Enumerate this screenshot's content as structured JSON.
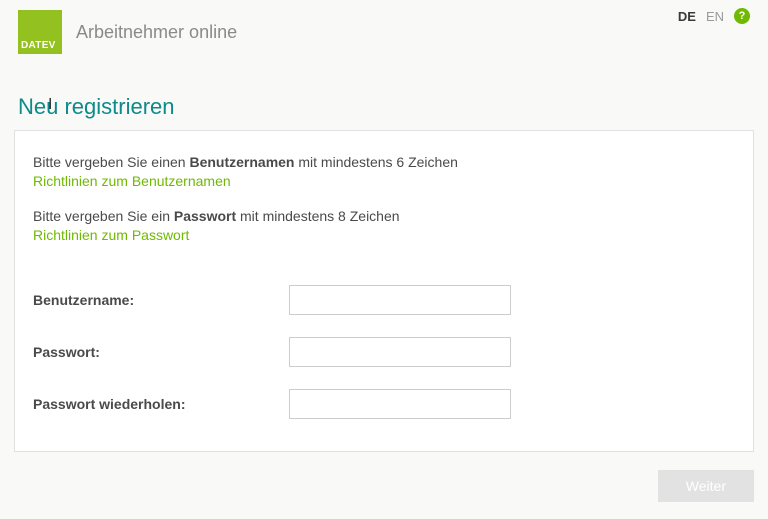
{
  "header": {
    "logo_text": "DATEV",
    "app_title": "Arbeitnehmer online",
    "lang_de": "DE",
    "lang_en": "EN",
    "help_symbol": "?"
  },
  "page": {
    "title": "Neu registrieren"
  },
  "panel": {
    "instr_username_pre": "Bitte vergeben Sie einen ",
    "instr_username_bold": "Benutzernamen",
    "instr_username_post": " mit mindestens 6 Zeichen",
    "link_username": "Richtlinien zum Benutzernamen",
    "instr_password_pre": "Bitte vergeben Sie ein ",
    "instr_password_bold": "Passwort",
    "instr_password_post": " mit mindestens 8 Zeichen",
    "link_password": "Richtlinien zum Passwort",
    "label_username": "Benutzername:",
    "label_password": "Passwort:",
    "label_password_repeat": "Passwort wiederholen:"
  },
  "footer": {
    "next_label": "Weiter"
  }
}
